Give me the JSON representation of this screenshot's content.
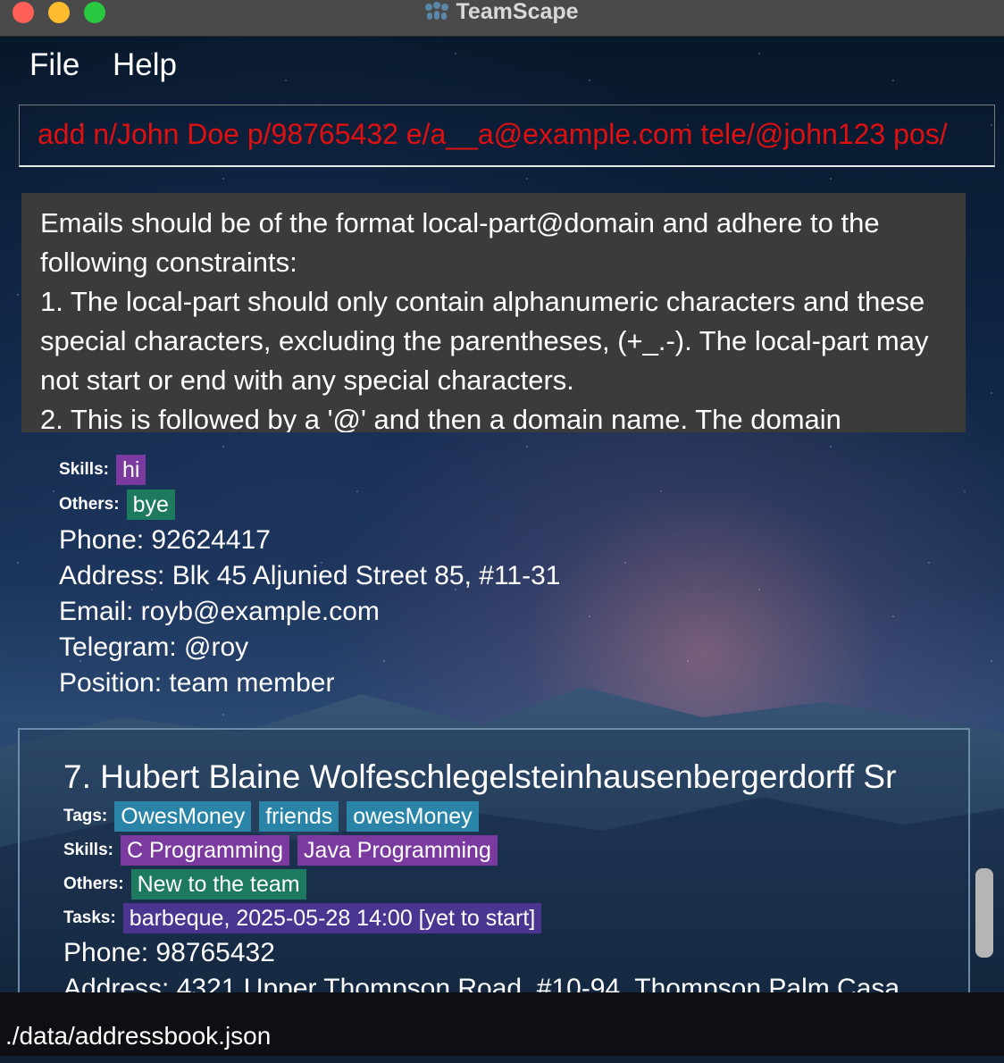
{
  "window": {
    "title": "TeamScape"
  },
  "menu": {
    "file": "File",
    "help": "Help"
  },
  "command_box": {
    "value": "add n/John Doe p/98765432 e/a__a@example.com tele/@john123 pos/"
  },
  "result_display": {
    "text": "Emails should be of the format local-part@domain and adhere to the following constraints:\n1. The local-part should only contain alphanumeric characters and these special characters, excluding the parentheses, (+_.-). The local-part may not start or end with any special characters.\n2. This is followed by a '@' and then a domain name. The domain"
  },
  "person_partial": {
    "skills_label": "Skills:",
    "skills": [
      "hi"
    ],
    "others_label": "Others:",
    "others": [
      "bye"
    ],
    "phone": "Phone: 92624417",
    "address": "Address: Blk 45 Aljunied Street 85, #11-31",
    "email": "Email: royb@example.com",
    "telegram": "Telegram: @roy",
    "position": "Position: team member"
  },
  "person_selected": {
    "name": "7. Hubert Blaine Wolfeschlegelsteinhausenbergerdorff Sr",
    "tags_label": "Tags:",
    "tags": [
      "OwesMoney",
      "friends",
      "owesMoney"
    ],
    "skills_label": "Skills:",
    "skills": [
      "C Programming",
      "Java Programming"
    ],
    "others_label": "Others:",
    "others": [
      "New to the team"
    ],
    "tasks_label": "Tasks:",
    "tasks": [
      "barbeque, 2025-05-28 14:00 [yet to start]"
    ],
    "phone": "Phone: 98765432",
    "address": "Address: 4321 Upper Thompson Road, #10-94, Thompson Palm Casa"
  },
  "status_bar": {
    "path": "./data/addressbook.json"
  },
  "colors": {
    "command_error": "#e01010",
    "tag": "#2a84a8",
    "skill": "#7a3aa0",
    "other": "#1e7a5e",
    "task": "#4a3690",
    "result_bg": "#3b3b3b"
  }
}
